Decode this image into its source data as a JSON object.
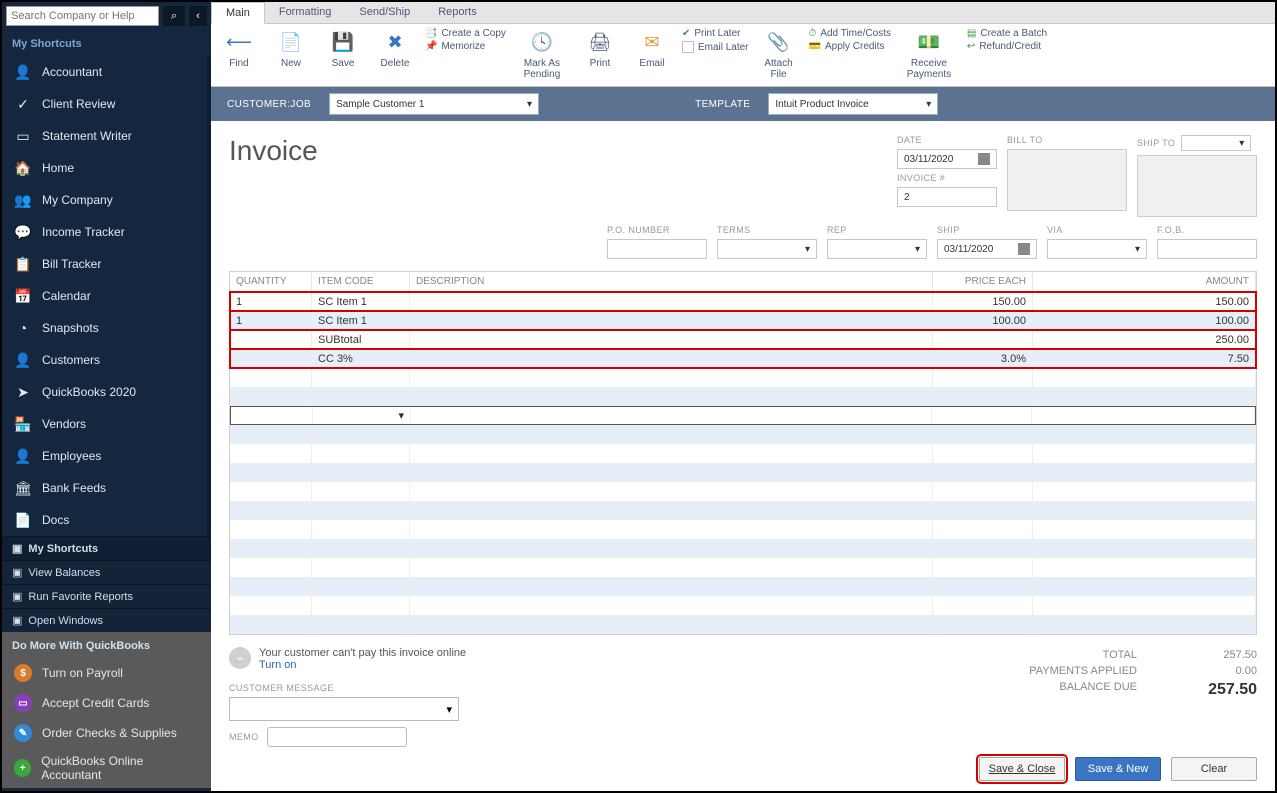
{
  "search": {
    "placeholder": "Search Company or Help"
  },
  "sidebar": {
    "shortcuts_title": "My Shortcuts",
    "items": [
      {
        "label": "Accountant",
        "icon": "👤"
      },
      {
        "label": "Client Review",
        "icon": "✓"
      },
      {
        "label": "Statement Writer",
        "icon": "▭"
      },
      {
        "label": "Home",
        "icon": "🏠"
      },
      {
        "label": "My Company",
        "icon": "👥"
      },
      {
        "label": "Income Tracker",
        "icon": "💬"
      },
      {
        "label": "Bill Tracker",
        "icon": "📋"
      },
      {
        "label": "Calendar",
        "icon": "📅"
      },
      {
        "label": "Snapshots",
        "icon": "◔"
      },
      {
        "label": "Customers",
        "icon": "👤"
      },
      {
        "label": "QuickBooks 2020",
        "icon": "➤"
      },
      {
        "label": "Vendors",
        "icon": "🏪"
      },
      {
        "label": "Employees",
        "icon": "👤"
      },
      {
        "label": "Bank Feeds",
        "icon": "🏛"
      },
      {
        "label": "Docs",
        "icon": "📄"
      }
    ],
    "minis": [
      {
        "label": "My Shortcuts",
        "icon": "▣"
      },
      {
        "label": "View Balances",
        "icon": "▣"
      },
      {
        "label": "Run Favorite Reports",
        "icon": "▣"
      },
      {
        "label": "Open Windows",
        "icon": "▣"
      }
    ],
    "domore_title": "Do More With QuickBooks",
    "domore": [
      {
        "label": "Turn on Payroll",
        "color": "#d97a2d",
        "glyph": "$"
      },
      {
        "label": "Accept Credit Cards",
        "color": "#8a3dbb",
        "glyph": "▭"
      },
      {
        "label": "Order Checks & Supplies",
        "color": "#2e8bd6",
        "glyph": "✎"
      },
      {
        "label": "QuickBooks Online Accountant",
        "color": "#3aa83a",
        "glyph": "+"
      }
    ]
  },
  "ribbon": {
    "tabs": [
      "Main",
      "Formatting",
      "Send/Ship",
      "Reports"
    ],
    "buttons": {
      "find": "Find",
      "new": "New",
      "save": "Save",
      "delete": "Delete",
      "memorize": "Memorize",
      "copy": "Create a Copy",
      "markpending": "Mark As Pending",
      "print": "Print",
      "email": "Email",
      "printlater": "Print Later",
      "emaillater": "Email Later",
      "attach": "Attach File",
      "addtime": "Add Time/Costs",
      "applycredits": "Apply Credits",
      "receive": "Receive Payments",
      "batch": "Create a Batch",
      "refund": "Refund/Credit"
    }
  },
  "custbar": {
    "customerjob_label": "CUSTOMER:JOB",
    "customerjob": "Sample Customer 1",
    "template_label": "TEMPLATE",
    "template": "Intuit Product Invoice"
  },
  "header": {
    "title": "Invoice",
    "date_label": "DATE",
    "date": "03/11/2020",
    "invno_label": "INVOICE #",
    "invno": "2",
    "billto_label": "BILL TO",
    "shipto_label": "SHIP TO"
  },
  "rowfields": {
    "pono": "P.O. NUMBER",
    "terms": "TERMS",
    "rep": "REP",
    "ship": "SHIP",
    "shipdate": "03/11/2020",
    "via": "VIA",
    "fob": "F.O.B."
  },
  "grid": {
    "cols": {
      "qty": "QUANTITY",
      "code": "ITEM CODE",
      "desc": "DESCRIPTION",
      "price": "PRICE EACH",
      "amt": "AMOUNT"
    },
    "rows": [
      {
        "qty": "1",
        "code": "SC Item 1",
        "desc": "",
        "price": "150.00",
        "amt": "150.00",
        "hl": true
      },
      {
        "qty": "1",
        "code": "SC Item 1",
        "desc": "",
        "price": "100.00",
        "amt": "100.00",
        "hl": true
      },
      {
        "qty": "",
        "code": "SUBtotal",
        "desc": "",
        "price": "",
        "amt": "250.00",
        "hl": true
      },
      {
        "qty": "",
        "code": "CC 3%",
        "desc": "",
        "price": "3.0%",
        "amt": "7.50",
        "hl": true
      }
    ]
  },
  "online": {
    "msg": "Your customer can't pay this invoice online",
    "link": "Turn on"
  },
  "custmsg_label": "CUSTOMER MESSAGE",
  "memo_label": "MEMO",
  "totals": {
    "total_label": "TOTAL",
    "total": "257.50",
    "payments_label": "PAYMENTS APPLIED",
    "payments": "0.00",
    "balance_label": "BALANCE DUE",
    "balance": "257.50"
  },
  "buttons": {
    "saveclose": "Save & Close",
    "savenew": "Save & New",
    "clear": "Clear"
  }
}
